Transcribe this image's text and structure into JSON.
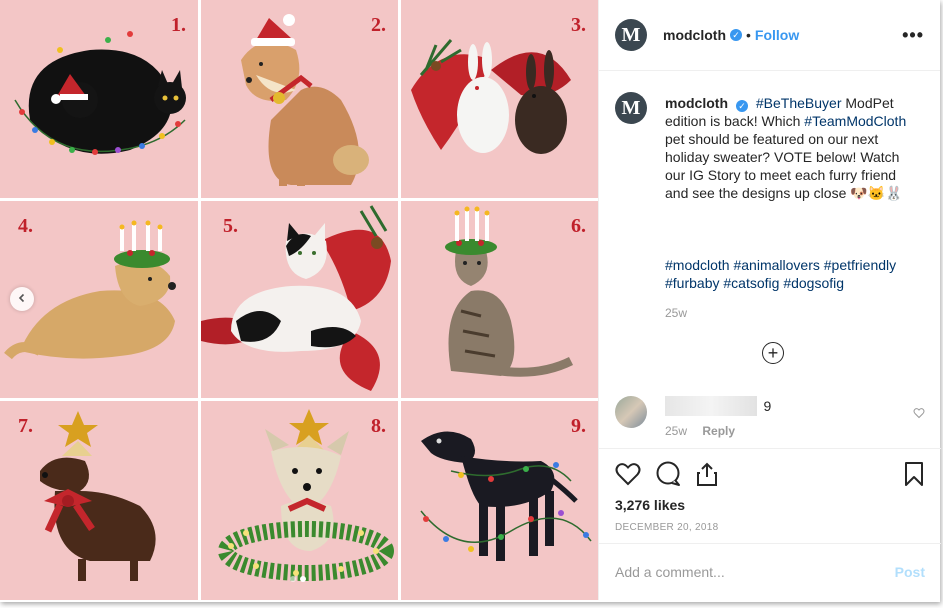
{
  "post": {
    "username": "modcloth",
    "avatar_letter": "M",
    "follow_label": "Follow",
    "separator": "•",
    "more_label": "•••"
  },
  "grid": {
    "numbers": [
      "1.",
      "2.",
      "3.",
      "4.",
      "5.",
      "6.",
      "7.",
      "8.",
      "9."
    ]
  },
  "caption": {
    "username": "modcloth",
    "segments": [
      {
        "text": "#BeTheBuyer",
        "tag": true
      },
      {
        "text": " ModPet edition is back! Which ",
        "tag": false
      },
      {
        "text": "#TeamModCloth",
        "tag": true
      },
      {
        "text": " pet should be featured on our next holiday sweater? VOTE below! Watch our IG Story to meet each furry friend and see the designs up close 🐶🐱🐰",
        "tag": false
      }
    ],
    "hashtags": [
      "#modcloth",
      "#animallovers",
      "#petfriendly",
      "#furbaby",
      "#catsofig",
      "#dogsofig"
    ],
    "age": "25w",
    "load_more": "+"
  },
  "comment": {
    "text": "9",
    "age": "25w",
    "reply_label": "Reply"
  },
  "actions": {
    "likes": "3,276 likes",
    "date": "DECEMBER 20, 2018"
  },
  "add_comment": {
    "placeholder": "Add a comment...",
    "post_label": "Post"
  },
  "colors": {
    "tile_bg": "#f3c6c6",
    "number": "#c0212b",
    "link": "#3897f0",
    "hashtag": "#003569"
  }
}
